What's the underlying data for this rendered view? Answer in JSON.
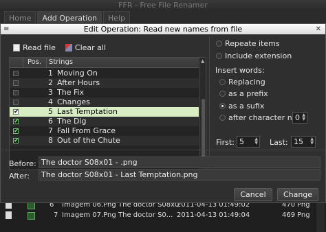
{
  "app": {
    "title": "FFR - Free File Renamer",
    "tabs": [
      "Home",
      "Add Operation",
      "Help"
    ]
  },
  "dialog": {
    "title": "Edit Operation: Read new names from file",
    "menu_glyph": "≡",
    "close_glyph": "✕",
    "toolbar": {
      "read_file": "Read file",
      "clear_all": "Clear all"
    },
    "table": {
      "headers": {
        "pos": "Pos.",
        "strings": "Strings"
      },
      "rows": [
        {
          "pos": "1",
          "string": "Moving On",
          "checked": false,
          "selected": false
        },
        {
          "pos": "2",
          "string": "After Hours",
          "checked": false,
          "selected": false
        },
        {
          "pos": "3",
          "string": "The Fix",
          "checked": false,
          "selected": false
        },
        {
          "pos": "4",
          "string": "Changes",
          "checked": false,
          "selected": false
        },
        {
          "pos": "5",
          "string": "Last Temptation",
          "checked": true,
          "selected": true
        },
        {
          "pos": "6",
          "string": "The Dig",
          "checked": true,
          "selected": false
        },
        {
          "pos": "7",
          "string": "Fall From Grace",
          "checked": true,
          "selected": false
        },
        {
          "pos": "8",
          "string": "Out of the Chute",
          "checked": true,
          "selected": false
        }
      ]
    },
    "options": {
      "repeat_items": "Repeate items",
      "include_extension": "Include extension",
      "insert_words": "Insert words:",
      "replacing": "Replacing",
      "as_prefix": "as a prefix",
      "as_suffix": "as a sufix",
      "after_char": "after character nº:",
      "after_char_value": "0",
      "first_label": "First:",
      "first_value": "5",
      "last_label": "Last:",
      "last_value": "15",
      "selected_mode": "as_suffix"
    },
    "preview": {
      "before_label": "Before:",
      "before_value": "The doctor S08x01 - .png",
      "after_label": "After:",
      "after_value": "The doctor S08x01 - Last Temptation.png"
    },
    "buttons": {
      "cancel": "Cancel",
      "change": "Change"
    }
  },
  "background_rows": [
    {
      "num": "6",
      "name": "Imagem 06.Png",
      "new": "The doctor S08x0",
      "date": "2011-04-13 01:49:02",
      "size": "470",
      "type": "Png"
    },
    {
      "num": "7",
      "name": "Imagem 07.Png",
      "new": "The doctor S0...",
      "date": "2011-04-13 01:49:04",
      "size": "469",
      "type": "Png"
    }
  ]
}
